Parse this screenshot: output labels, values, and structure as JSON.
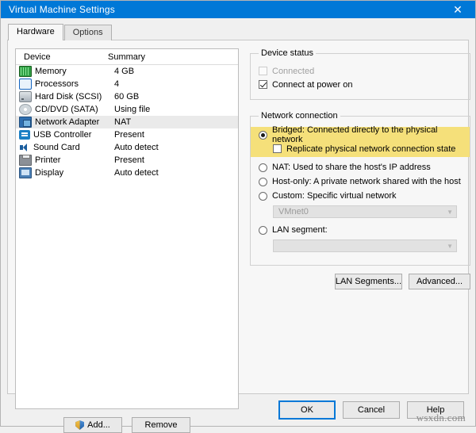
{
  "window": {
    "title": "Virtual Machine Settings",
    "close_icon": "close-icon"
  },
  "tabs": [
    {
      "label": "Hardware",
      "active": true
    },
    {
      "label": "Options",
      "active": false
    }
  ],
  "device_list": {
    "columns": {
      "device": "Device",
      "summary": "Summary"
    },
    "rows": [
      {
        "icon": "memory-icon",
        "name": "Memory",
        "summary": "4 GB",
        "selected": false
      },
      {
        "icon": "processor-icon",
        "name": "Processors",
        "summary": "4",
        "selected": false
      },
      {
        "icon": "hard-disk-icon",
        "name": "Hard Disk (SCSI)",
        "summary": "60 GB",
        "selected": false
      },
      {
        "icon": "cd-dvd-icon",
        "name": "CD/DVD (SATA)",
        "summary": "Using file",
        "selected": false
      },
      {
        "icon": "network-adapter-icon",
        "name": "Network Adapter",
        "summary": "NAT",
        "selected": true
      },
      {
        "icon": "usb-controller-icon",
        "name": "USB Controller",
        "summary": "Present",
        "selected": false
      },
      {
        "icon": "sound-card-icon",
        "name": "Sound Card",
        "summary": "Auto detect",
        "selected": false
      },
      {
        "icon": "printer-icon",
        "name": "Printer",
        "summary": "Present",
        "selected": false
      },
      {
        "icon": "display-icon",
        "name": "Display",
        "summary": "Auto detect",
        "selected": false
      }
    ],
    "add_button": "Add...",
    "remove_button": "Remove"
  },
  "device_status": {
    "legend": "Device status",
    "connected": {
      "label": "Connected",
      "checked": false,
      "disabled": true
    },
    "connect_at_power_on": {
      "label": "Connect at power on",
      "checked": true,
      "disabled": false
    }
  },
  "network_connection": {
    "legend": "Network connection",
    "options": [
      {
        "label": "Bridged: Connected directly to the physical network",
        "selected": true,
        "highlighted": true
      },
      {
        "label": "NAT: Used to share the host's IP address",
        "selected": false,
        "highlighted": false
      },
      {
        "label": "Host-only: A private network shared with the host",
        "selected": false,
        "highlighted": false
      },
      {
        "label": "Custom: Specific virtual network",
        "selected": false,
        "highlighted": false
      },
      {
        "label": "LAN segment:",
        "selected": false,
        "highlighted": false
      }
    ],
    "replicate_checkbox": {
      "label": "Replicate physical network connection state",
      "checked": false
    },
    "custom_dropdown": {
      "value": "VMnet0",
      "disabled": true
    },
    "lan_dropdown": {
      "value": "",
      "disabled": true
    },
    "lan_segments_button": "LAN Segments...",
    "advanced_button": "Advanced..."
  },
  "footer": {
    "ok": "OK",
    "cancel": "Cancel",
    "help": "Help",
    "watermark": "wsxdn.com"
  },
  "colors": {
    "titlebar": "#0078d7",
    "highlight_yellow": "#f5e07a",
    "selection_gray": "#eaeaea"
  }
}
